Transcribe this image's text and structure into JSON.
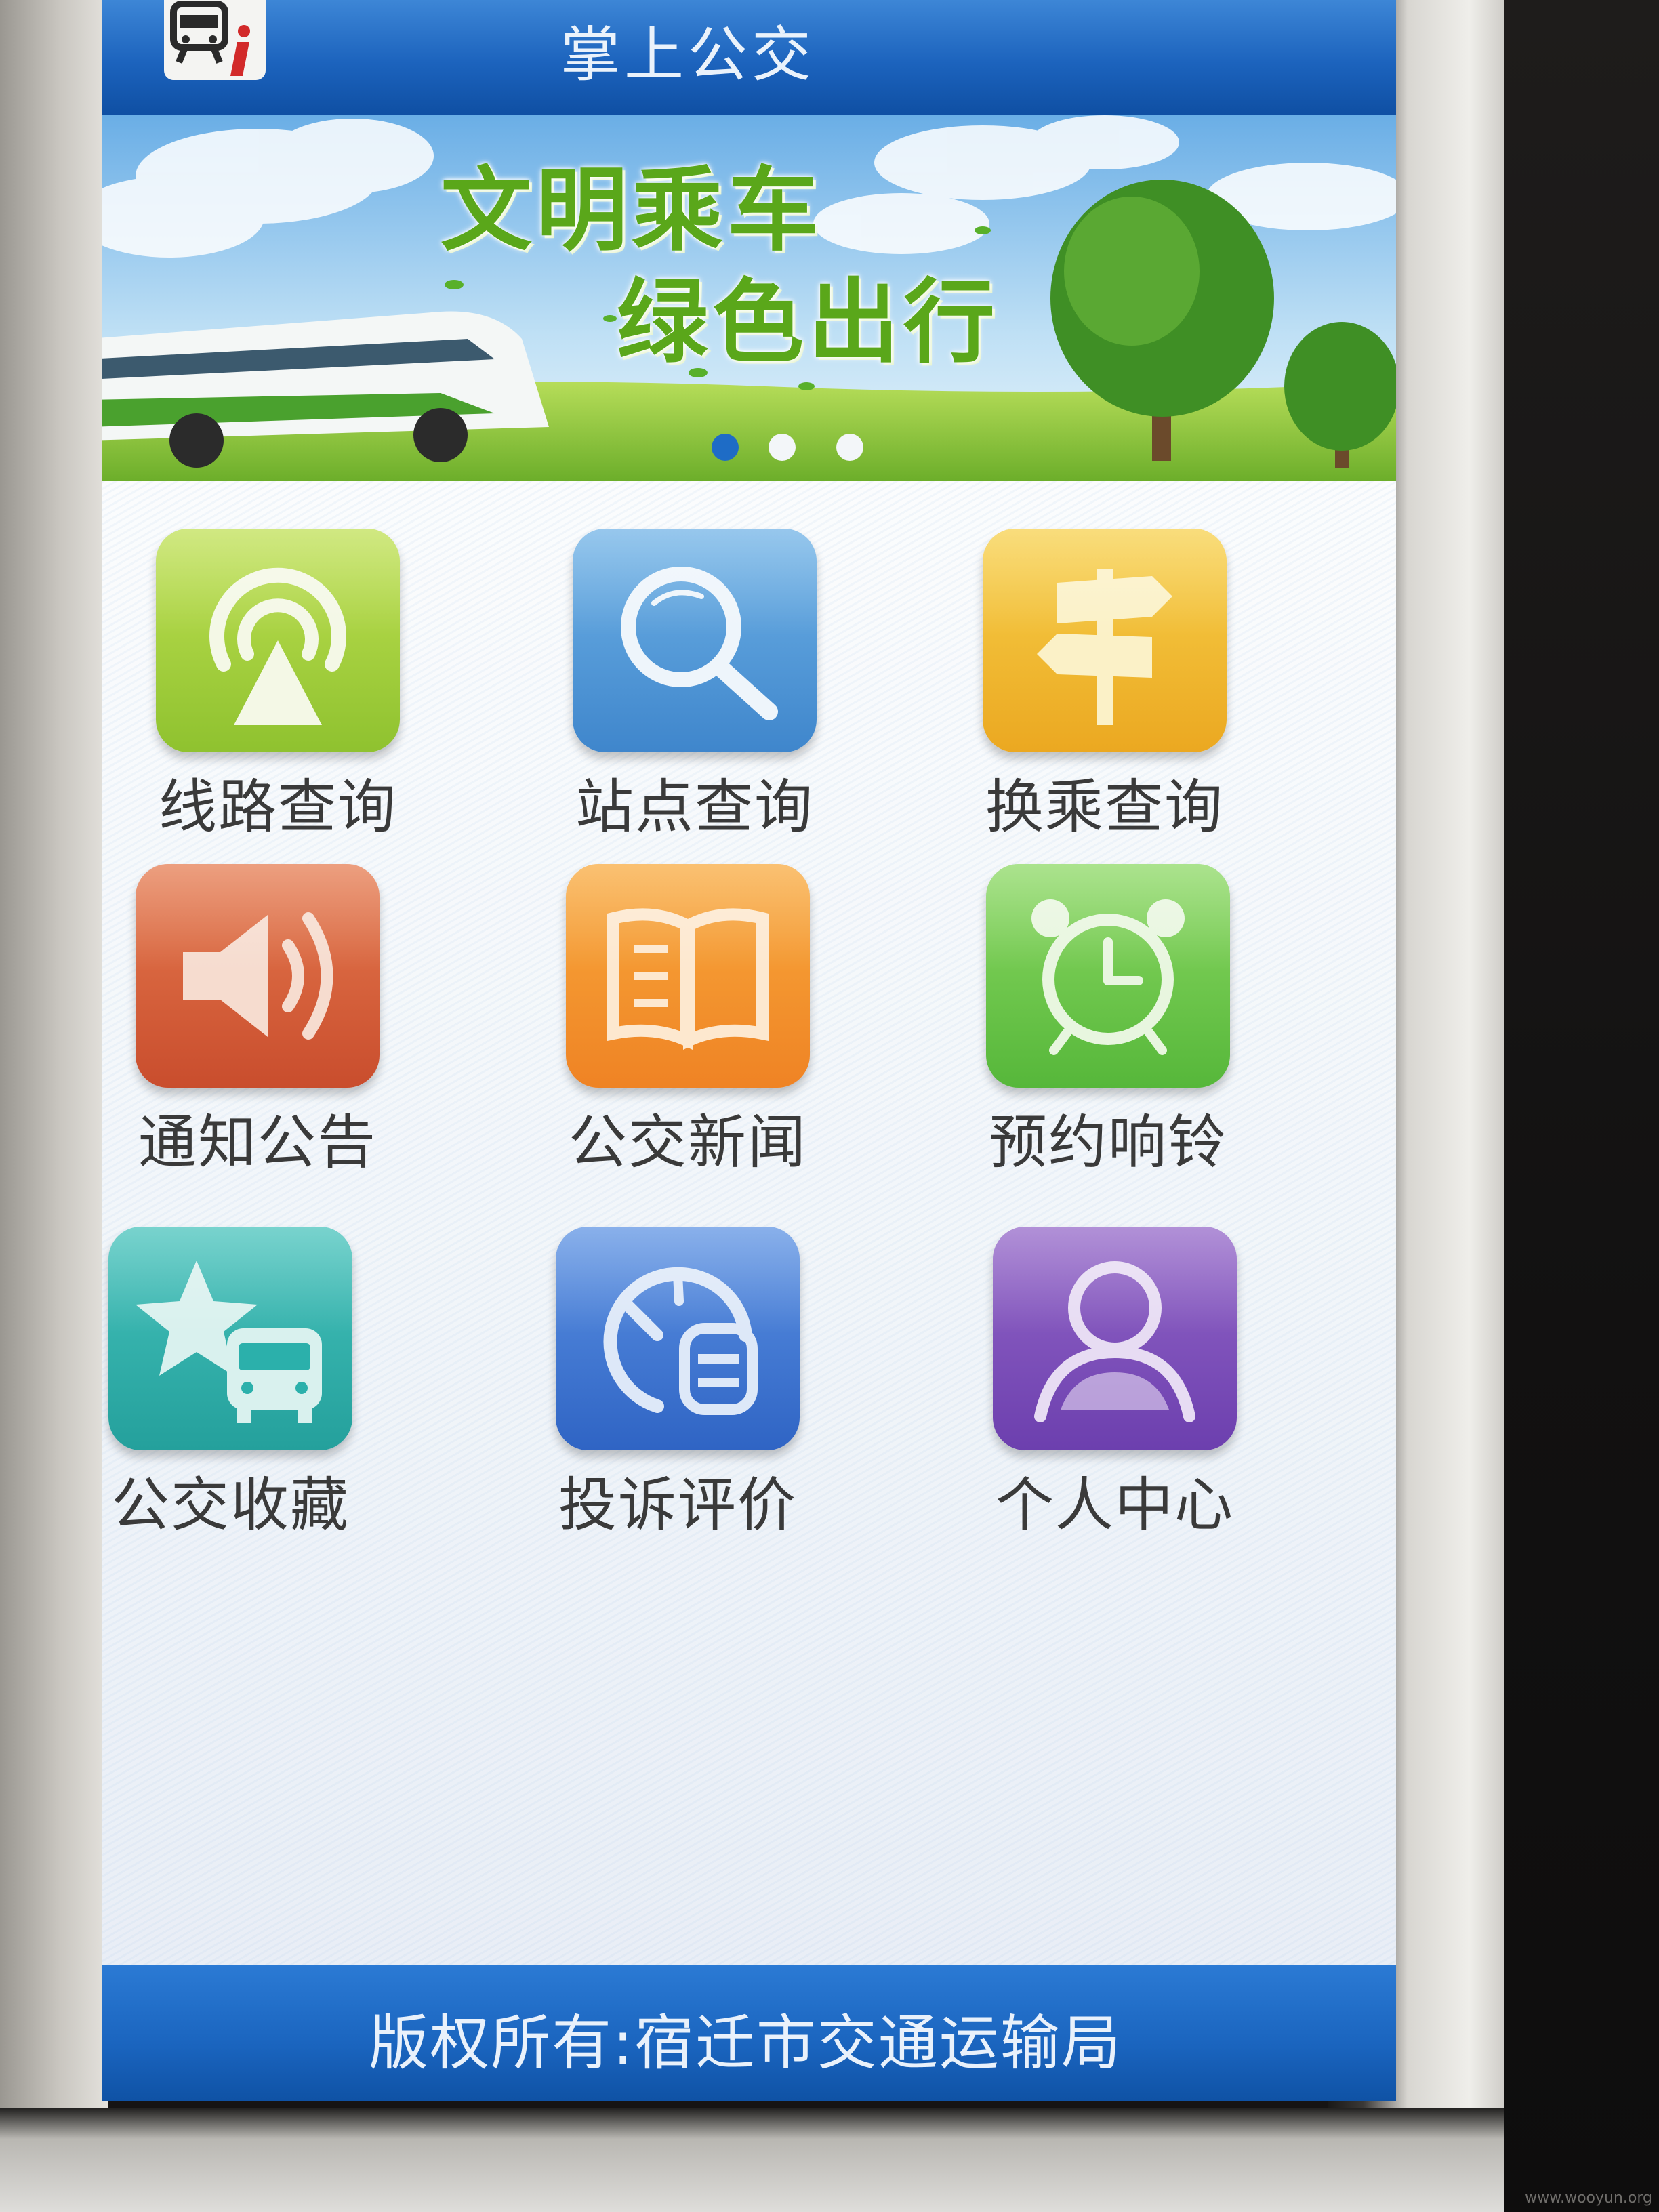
{
  "header": {
    "title": "掌上公交"
  },
  "banner": {
    "line1": "文明乘车",
    "line2": "绿色出行",
    "slide_count": 3,
    "active_slide": 1
  },
  "menu": [
    {
      "label": "线路查询",
      "icon": "broadcast-icon",
      "color": "#9fcf3a"
    },
    {
      "label": "站点查询",
      "icon": "magnifier-icon",
      "color": "#4f9ad6"
    },
    {
      "label": "换乘查询",
      "icon": "signpost-icon",
      "color": "#f0bc2e"
    },
    {
      "label": "通知公告",
      "icon": "speaker-icon",
      "color": "#d9633e"
    },
    {
      "label": "公交新闻",
      "icon": "book-icon",
      "color": "#f3922f"
    },
    {
      "label": "预约响铃",
      "icon": "alarm-clock-icon",
      "color": "#6cc64b"
    },
    {
      "label": "公交收藏",
      "icon": "star-bus-icon",
      "color": "#2fb1ad"
    },
    {
      "label": "投诉评价",
      "icon": "gauge-icon",
      "color": "#3f78d3"
    },
    {
      "label": "个人中心",
      "icon": "person-icon",
      "color": "#7f4fb7"
    }
  ],
  "footer": {
    "copyright": "版权所有:宿迁市交通运输局"
  },
  "watermark": "www.wooyun.org"
}
